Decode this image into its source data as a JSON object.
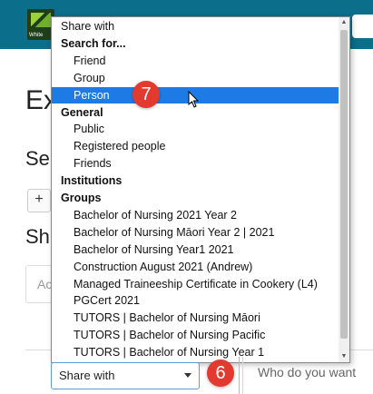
{
  "header": {
    "logo_text": "White",
    "logo_icon": "organisation-logo"
  },
  "background": {
    "heading_1": "Ex",
    "heading_2": "Se",
    "add_icon": "plus-icon",
    "add_label": "+",
    "heading_3": "Sh",
    "field_text": "Ac"
  },
  "dropdown": {
    "items": [
      {
        "label": "Share with",
        "level": 1,
        "header": false,
        "selected": false
      },
      {
        "label": "Search for...",
        "level": 1,
        "header": true,
        "selected": false
      },
      {
        "label": "Friend",
        "level": 2,
        "header": false,
        "selected": false
      },
      {
        "label": "Group",
        "level": 2,
        "header": false,
        "selected": false
      },
      {
        "label": "Person",
        "level": 2,
        "header": false,
        "selected": true
      },
      {
        "label": "General",
        "level": 1,
        "header": true,
        "selected": false
      },
      {
        "label": "Public",
        "level": 2,
        "header": false,
        "selected": false
      },
      {
        "label": "Registered people",
        "level": 2,
        "header": false,
        "selected": false
      },
      {
        "label": "Friends",
        "level": 2,
        "header": false,
        "selected": false
      },
      {
        "label": "Institutions",
        "level": 1,
        "header": true,
        "selected": false
      },
      {
        "label": "Groups",
        "level": 1,
        "header": true,
        "selected": false
      },
      {
        "label": "Bachelor of Nursing 2021 Year 2",
        "level": 2,
        "header": false,
        "selected": false
      },
      {
        "label": "Bachelor of Nursing Māori Year 2 | 2021",
        "level": 2,
        "header": false,
        "selected": false
      },
      {
        "label": "Bachelor of Nursing Year1 2021",
        "level": 2,
        "header": false,
        "selected": false
      },
      {
        "label": "Construction August 2021 (Andrew)",
        "level": 2,
        "header": false,
        "selected": false
      },
      {
        "label": "Managed Traineeship Certificate in Cookery (L4)",
        "level": 2,
        "header": false,
        "selected": false
      },
      {
        "label": "PGCert 2021",
        "level": 2,
        "header": false,
        "selected": false
      },
      {
        "label": "TUTORS | Bachelor of Nursing Māori",
        "level": 2,
        "header": false,
        "selected": false
      },
      {
        "label": "TUTORS | Bachelor of Nursing Pacific",
        "level": 2,
        "header": false,
        "selected": false
      },
      {
        "label": "TUTORS | Bachelor of Nursing Year 1",
        "level": 2,
        "header": false,
        "selected": false
      }
    ],
    "scroll_up_icon": "scroll-up-arrow-icon",
    "scroll_down_icon": "scroll-down-arrow-icon"
  },
  "annotations": {
    "step_7": "7",
    "step_6": "6",
    "badge_color": "#e23a2f"
  },
  "share_select": {
    "value": "Share with",
    "caret_icon": "caret-down-icon"
  },
  "who_prompt": "Who do you want",
  "colors": {
    "selection": "#1e7be6",
    "header_bar": "#0b6e8a"
  }
}
